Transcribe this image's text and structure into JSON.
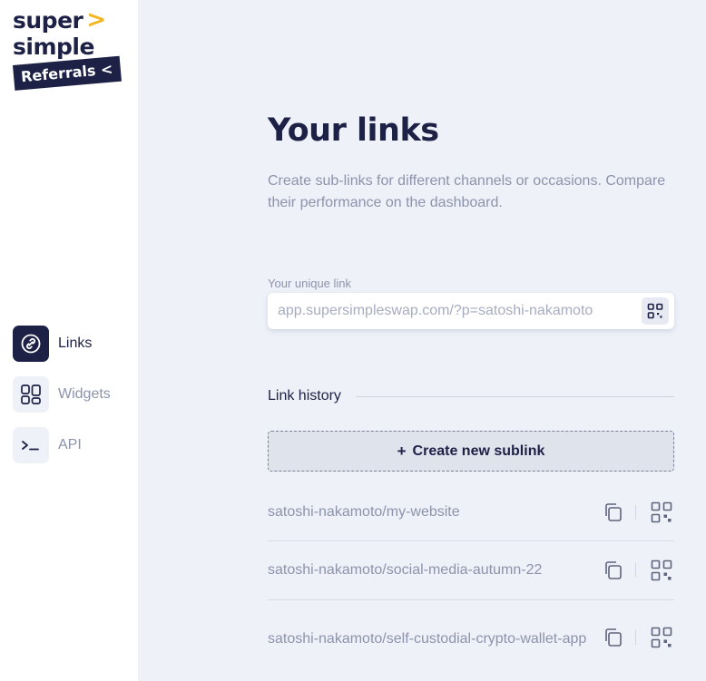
{
  "brand": {
    "line1": "super",
    "line2": "simple",
    "chevron": ">",
    "tag": "Referrals <",
    "colors": {
      "navy": "#1d2145",
      "accent": "#f3b61f"
    }
  },
  "sidebar": {
    "items": [
      {
        "label": "Links",
        "icon": "link-icon",
        "active": true
      },
      {
        "label": "Widgets",
        "icon": "widgets-icon",
        "active": false
      },
      {
        "label": "API",
        "icon": "terminal-icon",
        "active": false
      }
    ]
  },
  "main": {
    "title": "Your links",
    "subtitle": "Create sub-links for different channels or occasions. Compare their performance on the dashboard.",
    "unique_link": {
      "label": "Your unique link",
      "value": "app.supersimpleswap.com/?p=satoshi-nakamoto",
      "icon": "qr-code-icon"
    },
    "history": {
      "title": "Link history",
      "create_label": "Create new sublink",
      "create_plus": "+",
      "rows": [
        {
          "name": "satoshi-nakamoto/my-website"
        },
        {
          "name": "satoshi-nakamoto/social-media-autumn-22"
        },
        {
          "name": "satoshi-nakamoto/self-custodial-crypto-wallet-app"
        }
      ]
    }
  }
}
